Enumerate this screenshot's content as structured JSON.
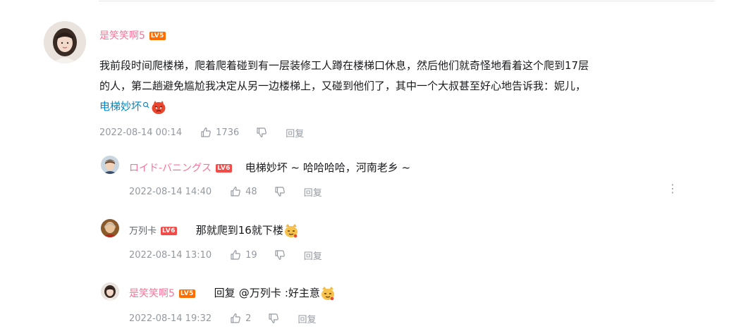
{
  "main_comment": {
    "username": "是笑笑啊5",
    "level": "LV5",
    "content_lines": [
      "我前段时间爬楼梯，爬着爬着碰到有一层装修工人蹲在楼梯口休息，然后他们就奇怪地看着这个爬到17层",
      "的人，第二趟避免尴尬我决定从另一边楼梯上，又碰到他们了，其中一个大叔甚至好心地告诉我：妮儿，"
    ],
    "search_link": "电梯妙坏",
    "date": "2022-08-14 00:14",
    "likes": "1736",
    "reply_label": "回复",
    "emoji": "angry-face-emoji"
  },
  "replies": [
    {
      "username": "ロイド-バニングス",
      "level": "LV6",
      "text": "电梯妙坏 ~ 哈哈哈哈，河南老乡 ~",
      "date": "2022-08-14 14:40",
      "likes": "48",
      "reply_label": "回复"
    },
    {
      "username": "万列卡",
      "level": "LV6",
      "text": "那就爬到16就下楼",
      "date": "2022-08-14 13:10",
      "likes": "19",
      "reply_label": "回复",
      "emoji": "cat-emoji"
    },
    {
      "username": "是笑笑啊5",
      "level": "LV5",
      "reply_prefix": "回复",
      "mention": "@万列卡",
      "text": ":好主意",
      "date": "2022-08-14 19:32",
      "likes": "2",
      "reply_label": "回复",
      "emoji": "cat-emoji"
    }
  ],
  "colors": {
    "username_pink": "#fb7299",
    "link_blue": "#008ac5",
    "meta_gray": "#9499a0",
    "lv5_orange": "#ff6c00",
    "lv6_red": "#f04c49"
  }
}
